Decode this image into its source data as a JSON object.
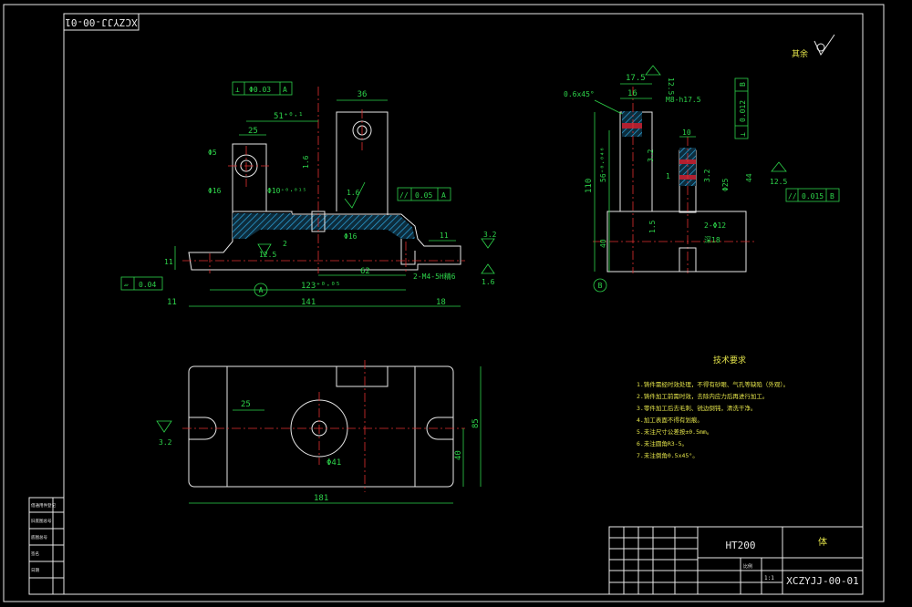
{
  "drawing": {
    "stamp_text": "XCZYJJ-00-01",
    "roughness_other": "其余",
    "material": "HT200",
    "part_name": "体",
    "drawing_number": "XCZYJJ-00-01",
    "scale_label": "比例",
    "sheet_label": "1:1"
  },
  "front_view": {
    "dim_36": "36",
    "dim_25": "25",
    "dim_51": "51⁺⁰·¹",
    "dim_phi5": "Φ5",
    "dim_phi16_left": "Φ16",
    "dim_phi10": "Φ10⁺⁰·⁰¹⁵",
    "dim_1_6a": "1.6",
    "dim_1_6b": "1.6",
    "dim_phi16_mid": "Φ16",
    "dim_12_5": "12.5",
    "dim_2": "2",
    "dim_11_left": "11",
    "dim_11_right": "11",
    "dim_3_2": "3.2",
    "dim_62": "62",
    "dim_123": "123⁺⁰·⁰⁵",
    "dim_thread": "2-M4-5H精6",
    "dim_141": "141",
    "dim_18": "18",
    "dim_11_bottom": "11",
    "dim_1_6c": "1.6",
    "datum_A": "A",
    "gdt_perp": [
      "⊥",
      "Φ0.03",
      "A"
    ],
    "gdt_par": [
      "//",
      "0.05",
      "A"
    ],
    "gdt_flat": [
      "▱",
      "0.04"
    ]
  },
  "side_view": {
    "dim_17_5": "17.5",
    "dim_12_5_top": "12.5",
    "dim_chamfer": "0.6x45°",
    "dim_16": "16",
    "dim_m8": "M8-h17.5",
    "dim_10": "10",
    "dim_3_2a": "3.2",
    "dim_3_2b": "3.2",
    "dim_1": "1",
    "dim_110": "110",
    "dim_56": "56⁺⁰·⁰⁴⁶",
    "dim_phi25": "Φ25",
    "dim_44": "44",
    "dim_12_5_right": "12.5",
    "dim_40": "40",
    "dim_1_5": "1.5",
    "dim_2phi12": "2-Φ12",
    "dim_depth18": "深18",
    "datum_B": "B",
    "gdt_perp_b": [
      "⊥",
      "0.012",
      "B"
    ],
    "gdt_par_b": [
      "//",
      "0.015",
      "B"
    ]
  },
  "top_view": {
    "dim_25": "25",
    "dim_3_2": "3.2",
    "dim_phi41": "Φ41",
    "dim_85": "85",
    "dim_40": "40",
    "dim_181": "181"
  },
  "tech_req": {
    "title": "技术要求",
    "lines": [
      "1.铸件需经时效处理，不得有砂眼、气孔等缺陷（外观）。",
      "2.铸件加工前需时效，去除内应力后再进行加工。",
      "3.零件加工后去毛刺、锐边倒钝，清洗干净。",
      "4.加工表面不得有划痕。",
      "5.未注尺寸公差按±0.5mm。",
      "6.未注圆角R3-5。",
      "7.未注倒角0.5x45°。"
    ]
  },
  "left_strip": [
    "借通用件登记",
    "旧底图总号",
    "底图总号",
    "签名",
    "日期"
  ]
}
